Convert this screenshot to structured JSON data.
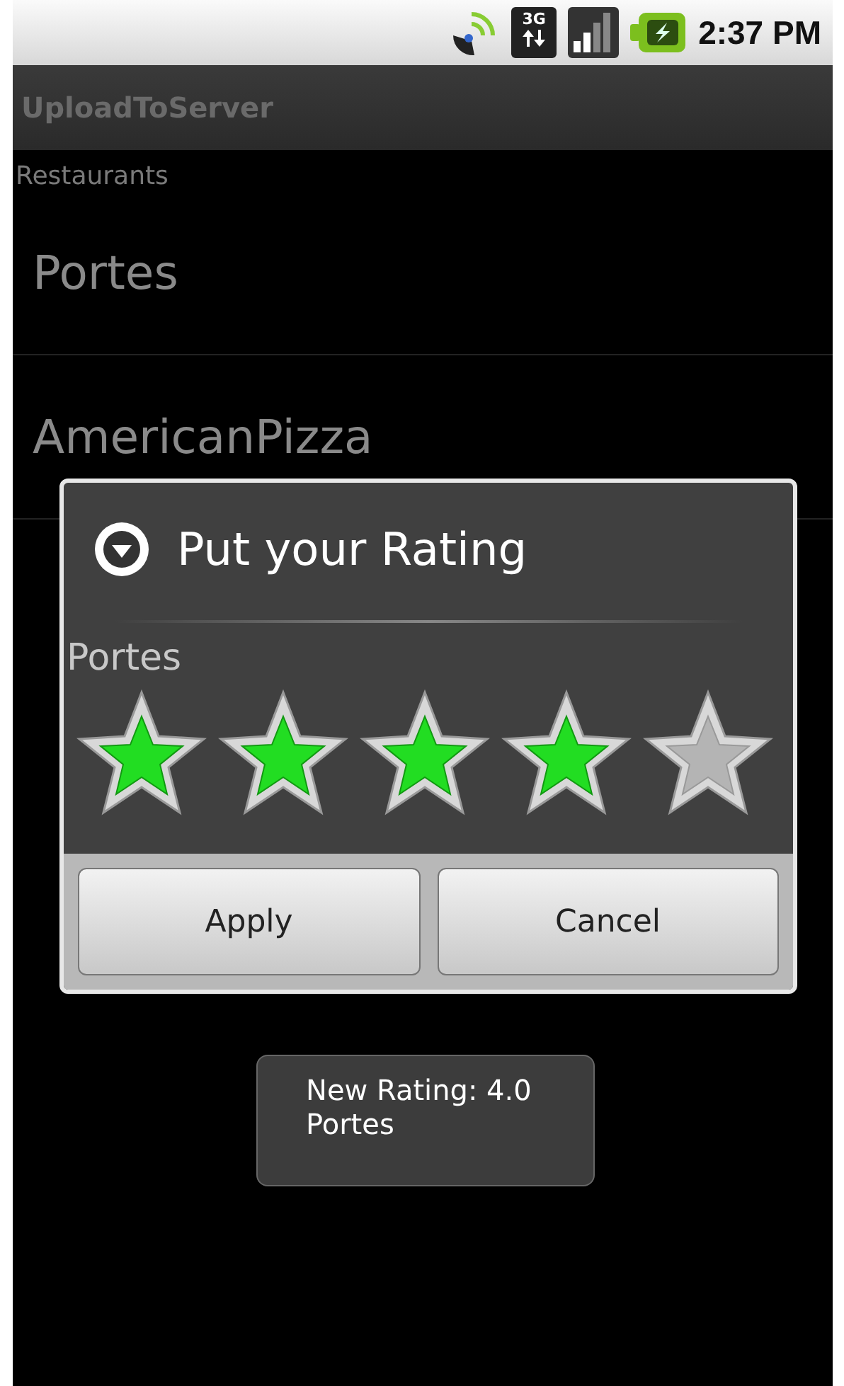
{
  "status_bar": {
    "network": "3G",
    "time": "2:37 PM"
  },
  "title_bar": {
    "title": "UploadToServer"
  },
  "header": "Restaurants",
  "list": [
    {
      "name": "Portes"
    },
    {
      "name": "AmericanPizza"
    }
  ],
  "dialog": {
    "title": "Put your Rating",
    "subject": "Portes",
    "stars": 4,
    "buttons": [
      "Apply",
      "Cancel"
    ]
  },
  "toast": {
    "lines": [
      "New Rating: 4.0",
      "Portes"
    ]
  }
}
